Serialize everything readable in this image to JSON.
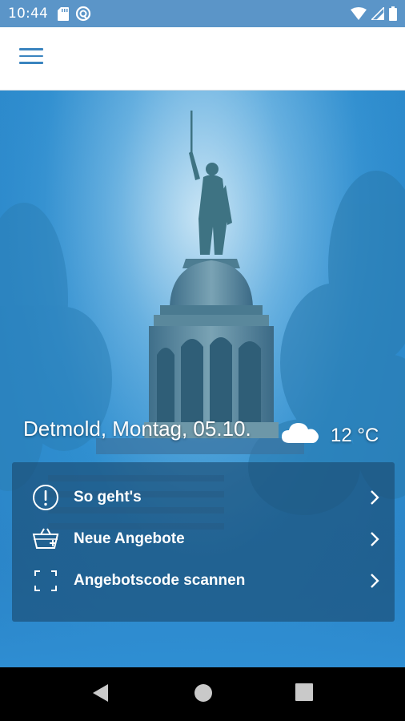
{
  "status_bar": {
    "time": "10:44",
    "left_icons": [
      "sd-card-icon",
      "sync-icon"
    ],
    "right_icons": [
      "wifi-icon",
      "signal-icon",
      "battery-icon"
    ]
  },
  "app_bar": {
    "menu_icon": "hamburger-menu-icon",
    "color": "#3a84bf"
  },
  "hero": {
    "location_date": "Detmold, Montag, 05.10.",
    "weather_icon": "cloud-icon",
    "temperature": "12 °C"
  },
  "menu": {
    "items": [
      {
        "label": "So geht's",
        "icon": "info-exclamation-icon"
      },
      {
        "label": "Neue Angebote",
        "icon": "basket-icon"
      },
      {
        "label": "Angebotscode scannen",
        "icon": "scan-frame-icon"
      }
    ]
  },
  "nav_bar": {
    "buttons": [
      "back-icon",
      "home-icon",
      "recents-icon"
    ]
  }
}
